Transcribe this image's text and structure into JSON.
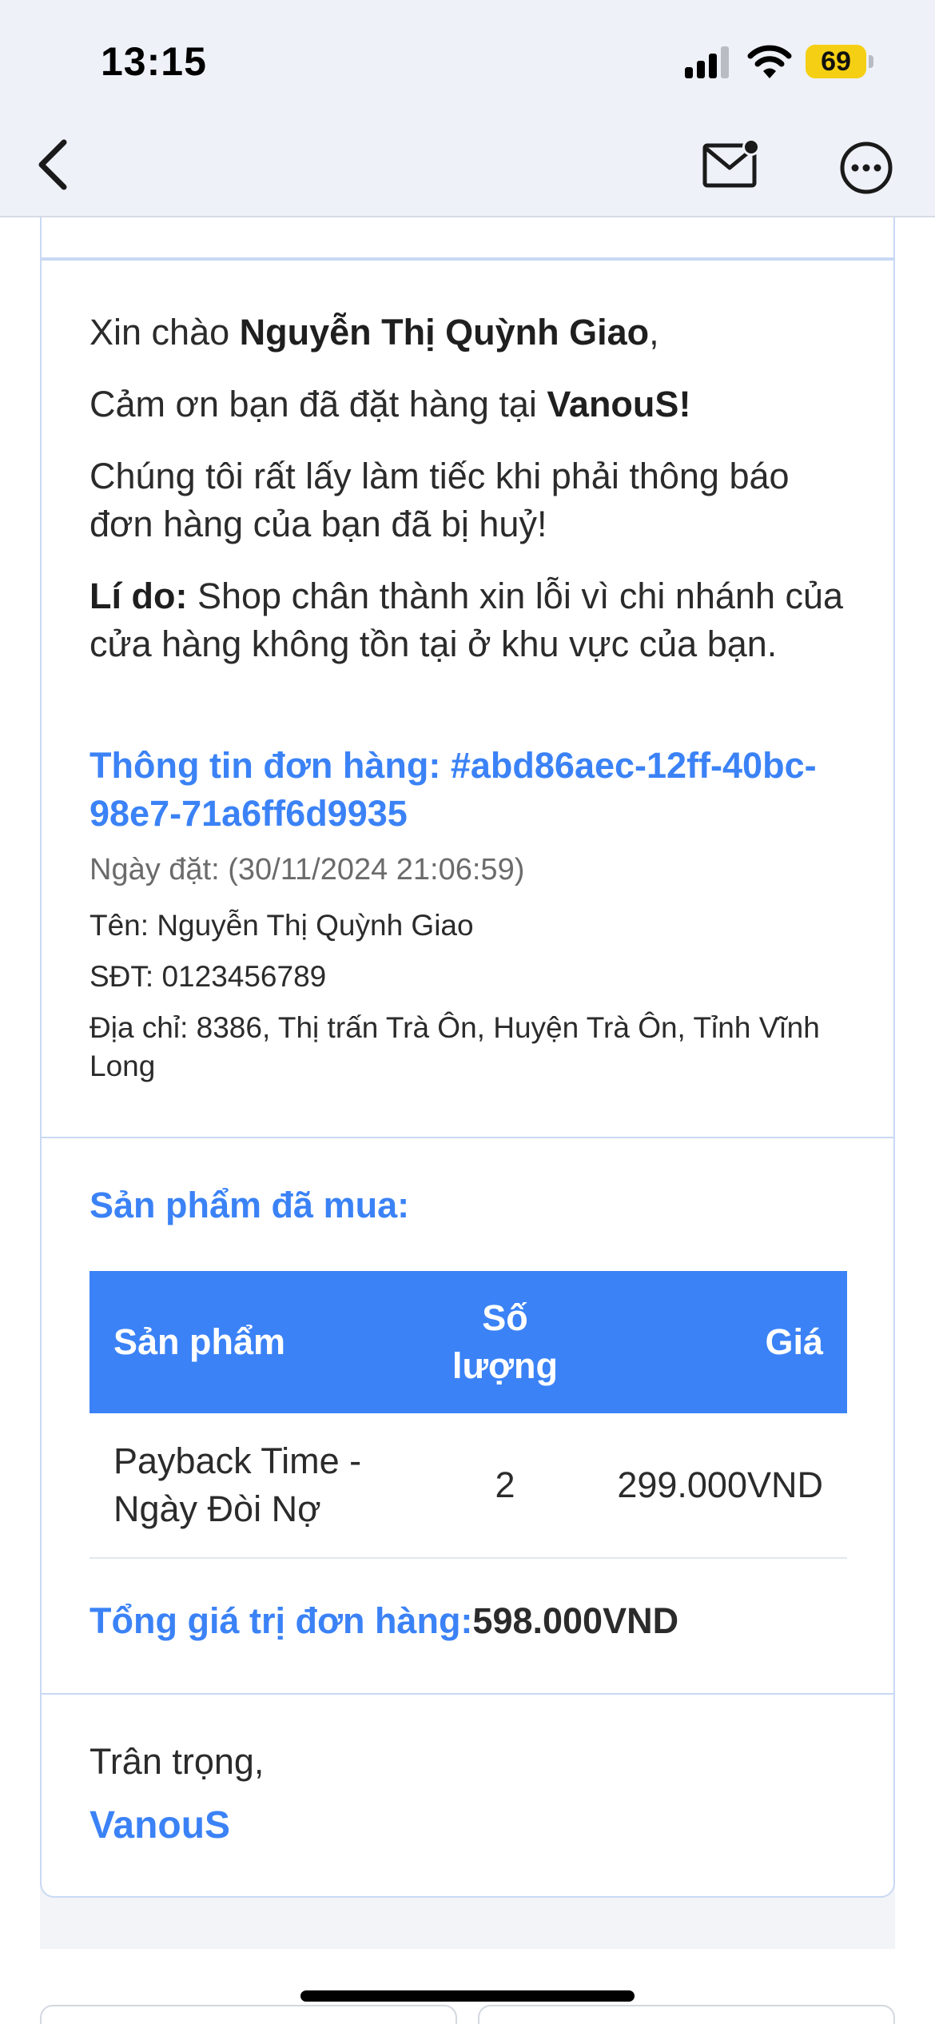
{
  "status_bar": {
    "time": "13:15",
    "battery": "69",
    "icons": [
      "cellular-signal-icon",
      "wifi-icon",
      "battery-icon"
    ]
  },
  "nav": {
    "icons": [
      "chevron-left-icon",
      "mail-unread-icon",
      "more-options-icon"
    ]
  },
  "email": {
    "greeting_prefix": "Xin chào ",
    "customer_name": "Nguyễn Thị Quỳnh Giao",
    "greeting_suffix": ",",
    "thanks_prefix": "Cảm ơn bạn đã đặt hàng tại ",
    "shop_name": "VanouS",
    "thanks_suffix": "!",
    "cancel_notice": "Chúng tôi rất lấy làm tiếc khi phải thông báo đơn hàng của bạn đã bị huỷ!",
    "reason_label": "Lí do:",
    "reason_text": " Shop chân thành xin lỗi vì chi nhánh của cửa hàng không tồn tại ở khu vực của bạn.",
    "order_info_title": "Thông tin đơn hàng: #abd86aec-12ff-40bc-98e7-71a6ff6d9935",
    "order_date": "Ngày đặt: (30/11/2024 21:06:59)",
    "name_line": "Tên: Nguyễn Thị Quỳnh Giao",
    "phone_line": "SĐT: 0123456789",
    "address_line": "Địa chỉ: 8386, Thị trấn Trà Ôn, Huyện Trà Ôn, Tỉnh Vĩnh Long",
    "products_title": "Sản phẩm đã mua:",
    "table": {
      "headers": [
        "Sản phẩm",
        "Số lượng",
        "Giá"
      ],
      "rows": [
        [
          "Payback Time - Ngày Đòi Nợ",
          "2",
          "299.000VND"
        ]
      ]
    },
    "total_label": "Tổng giá trị đơn hàng:",
    "total_value": "598.000VND",
    "regards": "Trân trọng,",
    "signature": "VanouS"
  },
  "colors": {
    "accent": "#3b82f6",
    "battery": "#f5cf13",
    "border": "#c9d9f4",
    "topbar": "#eef1f8"
  }
}
